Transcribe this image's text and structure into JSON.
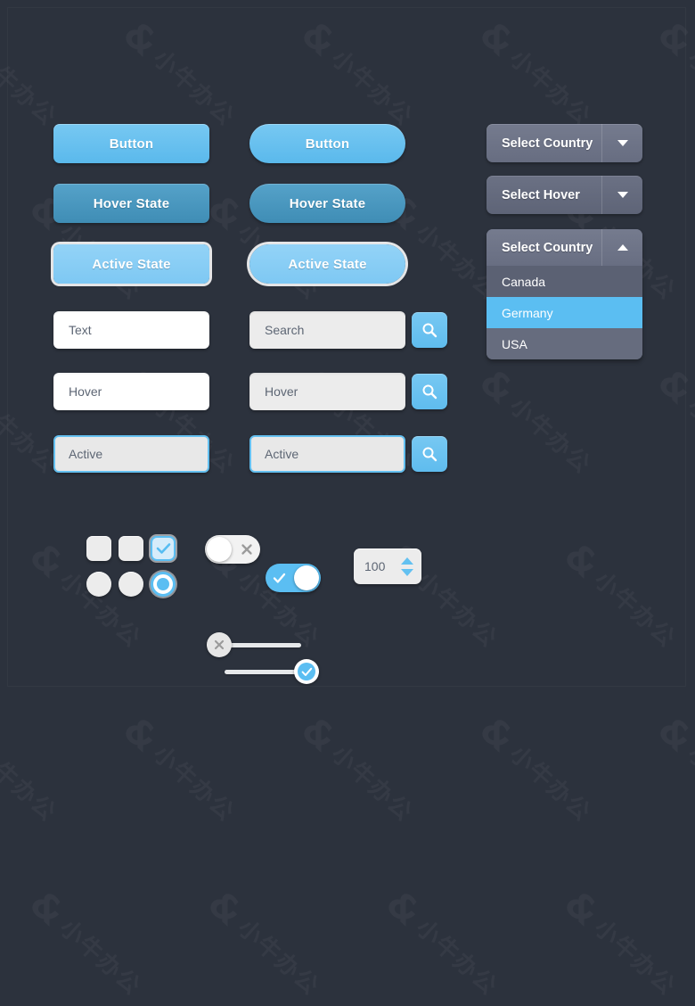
{
  "theme": {
    "background": "#2c323d",
    "accent_blue": "#5bbef2",
    "hover_blue": "#4795be",
    "active_blue": "#85cdf5",
    "select_grey": "#6b7185",
    "field_grey": "#ececec",
    "field_white": "#ffffff"
  },
  "watermark": {
    "logo": "&",
    "text": "小牛办公"
  },
  "buttons_rect": [
    {
      "label": "Button",
      "state": "normal"
    },
    {
      "label": "Hover State",
      "state": "hover"
    },
    {
      "label": "Active State",
      "state": "active"
    }
  ],
  "buttons_pill": [
    {
      "label": "Button",
      "state": "normal"
    },
    {
      "label": "Hover State",
      "state": "hover"
    },
    {
      "label": "Active State",
      "state": "active"
    }
  ],
  "selects": [
    {
      "label": "Select Country",
      "state": "normal",
      "arrow": "chevron-down-icon"
    },
    {
      "label": "Select Hover",
      "state": "hover",
      "arrow": "chevron-down-icon"
    }
  ],
  "select_open": {
    "label": "Select Country",
    "arrow": "chevron-up-icon",
    "options": [
      {
        "label": "Canada",
        "state": "hover"
      },
      {
        "label": "Germany",
        "state": "selected"
      },
      {
        "label": "USA",
        "state": "normal"
      }
    ]
  },
  "text_fields": [
    {
      "value": "Text",
      "state": "normal"
    },
    {
      "value": "Hover",
      "state": "hover"
    },
    {
      "value": "Active",
      "state": "active"
    }
  ],
  "search_fields": [
    {
      "value": "Search",
      "state": "normal",
      "icon": "search-icon"
    },
    {
      "value": "Hover",
      "state": "hover",
      "icon": "search-icon"
    },
    {
      "value": "Active",
      "state": "active",
      "icon": "search-icon"
    }
  ],
  "checkboxes": [
    {
      "state": "normal",
      "checked": false
    },
    {
      "state": "hover",
      "checked": false
    },
    {
      "state": "checked",
      "checked": true,
      "icon": "check-icon"
    }
  ],
  "radios": [
    {
      "state": "normal",
      "selected": false
    },
    {
      "state": "hover",
      "selected": false
    },
    {
      "state": "selected",
      "selected": true
    }
  ],
  "toggles": [
    {
      "state": "off",
      "icon": "close-icon"
    },
    {
      "state": "on",
      "icon": "check-icon"
    }
  ],
  "sliders": [
    {
      "state": "off",
      "icon": "close-icon",
      "position": "start"
    },
    {
      "state": "on",
      "icon": "check-icon",
      "position": "end"
    }
  ],
  "spinner": {
    "value": "100",
    "increment_icon": "caret-up-icon",
    "decrement_icon": "caret-down-icon"
  }
}
